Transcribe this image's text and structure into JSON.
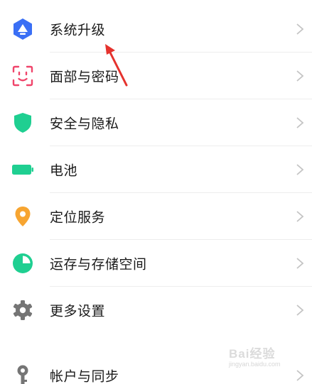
{
  "settings_list": {
    "items": [
      {
        "label": "系统升级",
        "icon": "system-update-icon",
        "color": "#3a6ff5"
      },
      {
        "label": "面部与密码",
        "icon": "face-id-icon",
        "color": "#f0456b"
      },
      {
        "label": "安全与隐私",
        "icon": "shield-icon",
        "color": "#1fcf91"
      },
      {
        "label": "电池",
        "icon": "battery-icon",
        "color": "#1fcf91"
      },
      {
        "label": "定位服务",
        "icon": "location-pin-icon",
        "color": "#f7a531"
      },
      {
        "label": "运存与存储空间",
        "icon": "pie-chart-icon",
        "color": "#1fcf91"
      },
      {
        "label": "更多设置",
        "icon": "gear-icon",
        "color": "#757575"
      },
      {
        "label": "帐户与同步",
        "icon": "key-icon",
        "color": "#757575"
      }
    ],
    "chevron_icon": "chevron-right-icon"
  },
  "annotation": {
    "icon": "red-arrow-icon",
    "color": "#e5322d"
  },
  "watermark": {
    "title": "Bai经验",
    "subtitle": "jingyan.baidu.com"
  }
}
